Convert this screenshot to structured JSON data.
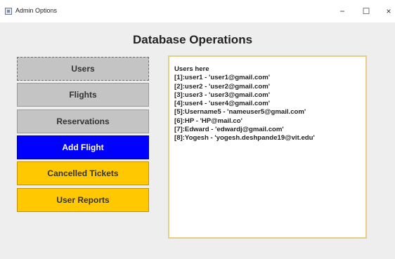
{
  "window": {
    "title": "Admin Options",
    "controls": {
      "minimize": "−",
      "maximize": "☐",
      "close": "×"
    }
  },
  "heading": "Database Operations",
  "menu": {
    "users": "Users",
    "flights": "Flights",
    "reservations": "Reservations",
    "add_flight": "Add Flight",
    "cancelled_tickets": "Cancelled Tickets",
    "user_reports": "User Reports"
  },
  "output": {
    "lines": [
      "Users here",
      "[1]:user1 - 'user1@gmail.com'",
      "[2]:user2 - 'user2@gmail.com'",
      "[3]:user3 - 'user3@gmail.com'",
      "[4]:user4 - 'user4@gmail.com'",
      "[5]:Username5 - 'nameuser5@gmail.com'",
      "[6]:HP - 'HP@mail.co'",
      "[7]:Edward - 'edwardj@gmail.com'",
      "[8]:Yogesh - 'yogesh.deshpande19@vit.edu'"
    ]
  },
  "colors": {
    "add_flight_bg": "#0000ff",
    "warning_bg": "#ffc800",
    "neutral_btn_bg": "#c4c4c4",
    "textarea_border": "#e6cf84"
  },
  "icons": {
    "app": "java-app-icon",
    "minimize": "minimize-icon",
    "maximize": "maximize-icon",
    "close": "close-icon"
  }
}
